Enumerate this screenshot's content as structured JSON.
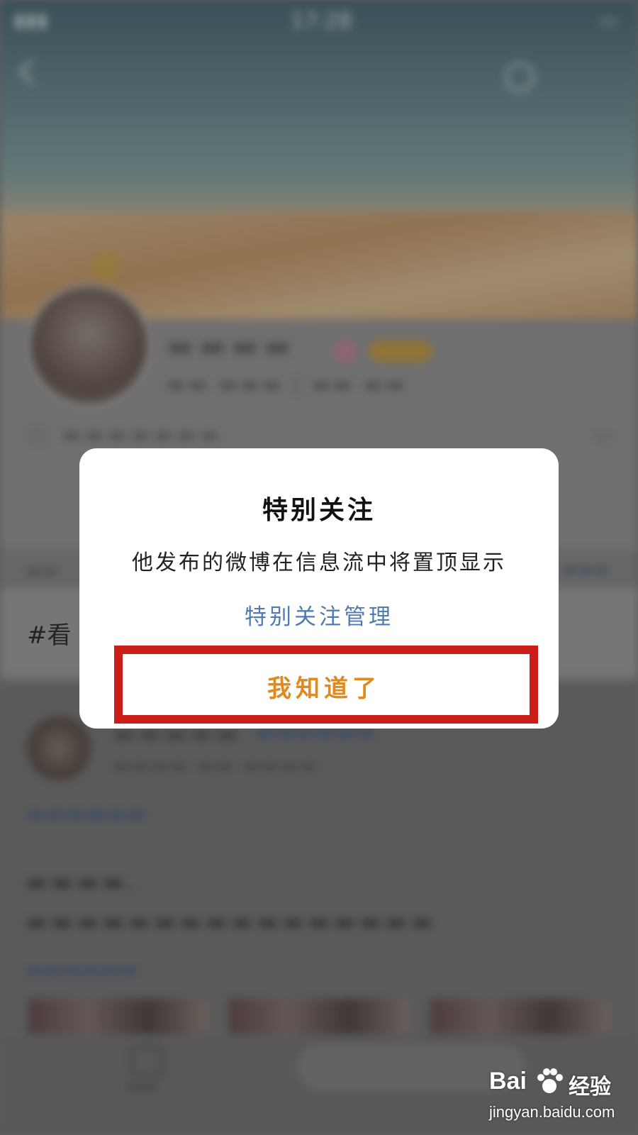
{
  "background": {
    "status_time": "17:28",
    "topic_prefix": "#看",
    "colors": {
      "accent_orange": "#e08a1e",
      "link_blue": "#4f7bb0",
      "highlight_red": "#cc1e18"
    }
  },
  "dialog": {
    "title": "特别关注",
    "message": "他发布的微博在信息流中将置顶显示",
    "link": "特别关注管理",
    "ok_label": "我知道了"
  },
  "watermark": {
    "logo": "Bai",
    "cn": "经验",
    "url": "jingyan.baidu.com"
  }
}
